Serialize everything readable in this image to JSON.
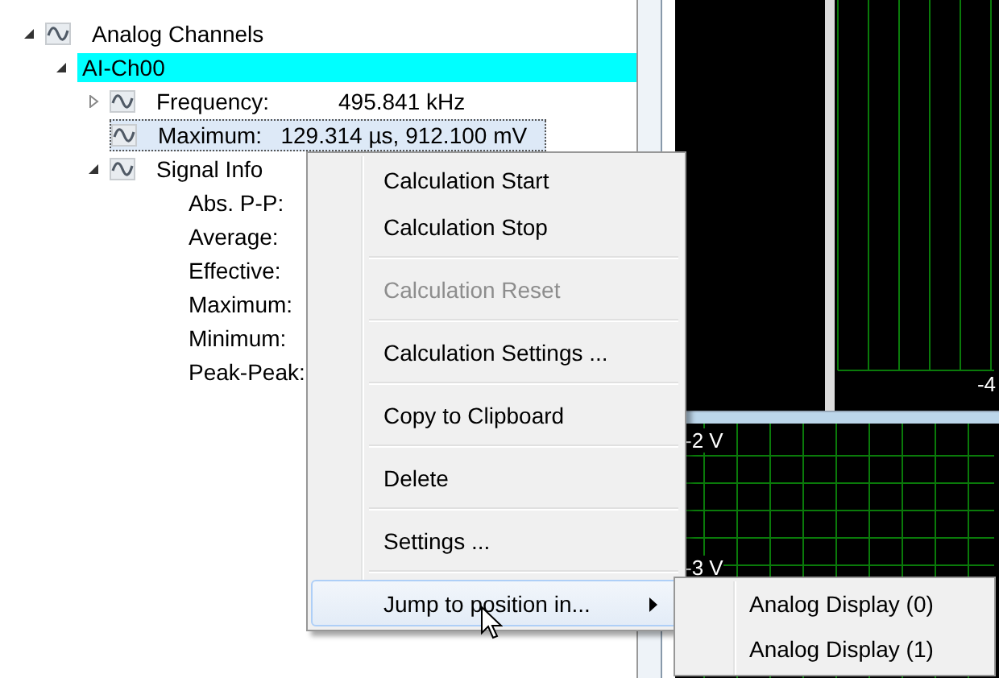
{
  "tree": [
    {
      "kind": "signal",
      "label": "Analog Channels",
      "expanded": true,
      "selected": false,
      "highlighted": false,
      "children": [
        {
          "kind": "channel",
          "label": "AI-Ch00",
          "expanded": true,
          "selected": false,
          "highlighted": true,
          "children": [
            {
              "kind": "signal",
              "label": "Frequency:",
              "value": "495.841 kHz",
              "expanded": false,
              "selected": false,
              "highlighted": false
            },
            {
              "kind": "signal",
              "label": "Maximum:",
              "value": "129.314 µs, 912.100 mV",
              "selected": true,
              "highlighted": false
            },
            {
              "kind": "signal",
              "label": "Signal Info",
              "expanded": true,
              "selected": false,
              "highlighted": false,
              "children": [
                {
                  "kind": "field",
                  "label": "Abs. P-P:",
                  "selected": false,
                  "highlighted": false
                },
                {
                  "kind": "field",
                  "label": "Average:",
                  "selected": false,
                  "highlighted": false
                },
                {
                  "kind": "field",
                  "label": "Effective:",
                  "selected": false,
                  "highlighted": false
                },
                {
                  "kind": "field",
                  "label": "Maximum:",
                  "selected": false,
                  "highlighted": false
                },
                {
                  "kind": "field",
                  "label": "Minimum:",
                  "selected": false,
                  "highlighted": false
                },
                {
                  "kind": "field",
                  "label": "Peak-Peak:",
                  "selected": false,
                  "highlighted": false
                }
              ]
            }
          ]
        }
      ]
    }
  ],
  "scopes": {
    "top_label": "-4",
    "bottom_labels": [
      "-2 V",
      "-3 V"
    ]
  },
  "context_menu": [
    [
      {
        "label": "Calculation Start",
        "disabled": false,
        "selected": false
      },
      {
        "label": "Calculation Stop",
        "disabled": false,
        "selected": false
      }
    ],
    [
      {
        "label": "Calculation Reset",
        "disabled": true,
        "selected": false
      }
    ],
    [
      {
        "label": "Calculation Settings ...",
        "disabled": false,
        "selected": false
      }
    ],
    [
      {
        "label": "Copy to Clipboard",
        "disabled": false,
        "selected": false
      }
    ],
    [
      {
        "label": "Delete",
        "disabled": false,
        "selected": false
      }
    ],
    [
      {
        "label": "Settings ...",
        "disabled": false,
        "selected": false
      }
    ],
    [
      {
        "label": "Jump to position in...",
        "disabled": false,
        "selected": true,
        "submenu": [
          {
            "label": "Analog Display (0)",
            "selected": false
          },
          {
            "label": "Analog Display (1)",
            "selected": false
          }
        ]
      }
    ]
  ]
}
